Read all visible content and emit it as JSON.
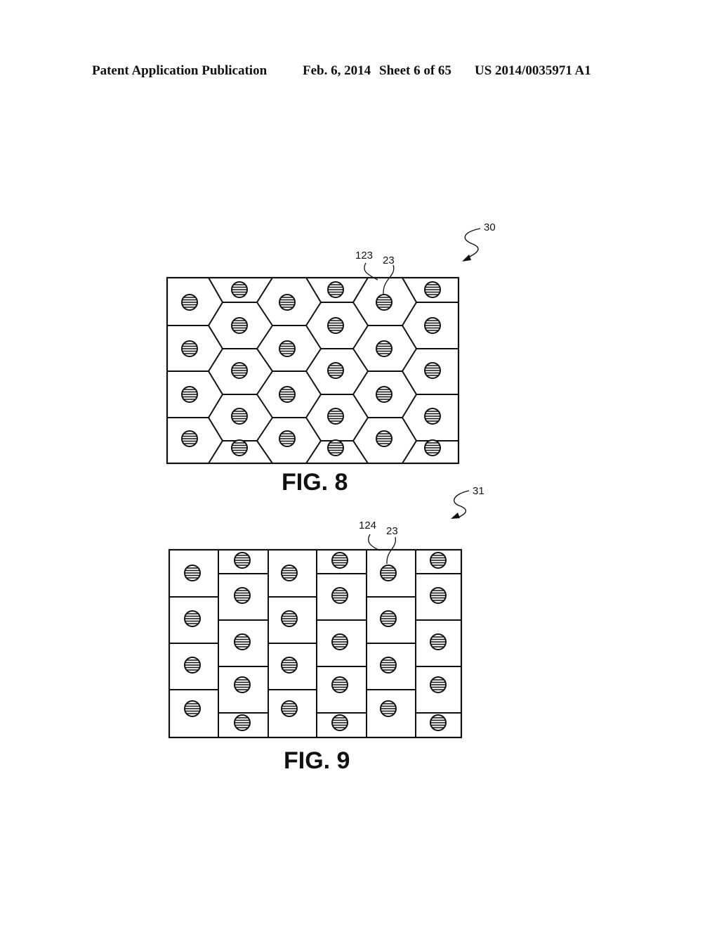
{
  "header": {
    "publication_type": "Patent Application Publication",
    "date": "Feb. 6, 2014",
    "sheet": "Sheet 6 of 65",
    "publication_number": "US 2014/0035971 A1"
  },
  "figures": [
    {
      "id": "fig8",
      "label": "FIG. 8",
      "assembly_ref": "30",
      "cell_ref": "123",
      "element_ref": "23",
      "cell_shape": "hexagon",
      "columns": 6,
      "description": "Hexagonal cell array, each cell containing a hatched circular element"
    },
    {
      "id": "fig9",
      "label": "FIG. 9",
      "assembly_ref": "31",
      "cell_ref": "124",
      "element_ref": "23",
      "cell_shape": "rectangle",
      "columns": 6,
      "description": "Staggered rectangular cell array, each cell containing a hatched circular element"
    }
  ]
}
